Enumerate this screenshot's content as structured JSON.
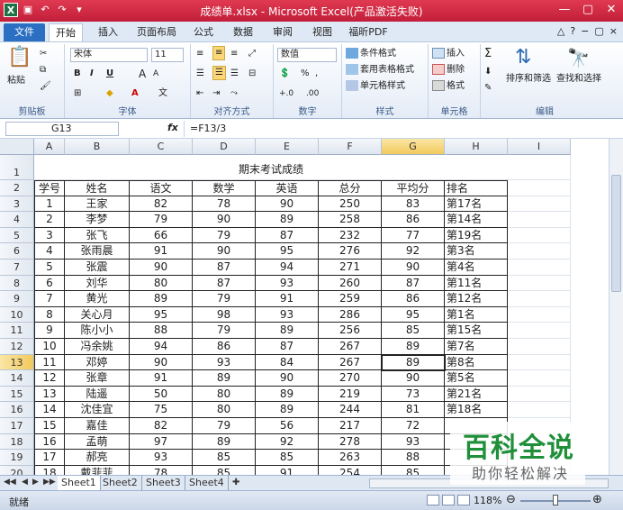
{
  "window": {
    "title": "成绩单.xlsx - Microsoft Excel(产品激活失败)",
    "controls": [
      "—",
      "▢",
      "✕"
    ]
  },
  "ribbon_tabs": [
    "文件",
    "开始",
    "插入",
    "页面布局",
    "公式",
    "数据",
    "审阅",
    "视图",
    "福昕PDF"
  ],
  "ribbon": {
    "clipboard": {
      "paste": "粘贴",
      "label": "剪贴板"
    },
    "font": {
      "name": "宋体",
      "size": "11",
      "bold": "B",
      "italic": "I",
      "underline": "U",
      "grow": "A",
      "shrink": "A",
      "label": "字体",
      "wen": "文"
    },
    "align": {
      "label": "对齐方式"
    },
    "number": {
      "format": "数值",
      "label": "数字",
      "percent": "%",
      "comma": ",",
      "inc": "+.0",
      "dec": ".00"
    },
    "styles": {
      "cond": "条件格式",
      "table": "套用表格格式",
      "cell": "单元格样式",
      "label": "样式"
    },
    "cells": {
      "insert": "插入",
      "delete": "删除",
      "format": "格式",
      "label": "单元格"
    },
    "editing": {
      "sigma": "Σ",
      "sort": "排序和筛选",
      "find": "查找和选择",
      "label": "编辑"
    }
  },
  "formula_bar": {
    "name_box": "G13",
    "fx": "fx",
    "formula": "=F13/3"
  },
  "columns": [
    "A",
    "B",
    "C",
    "D",
    "E",
    "F",
    "G",
    "H",
    "I"
  ],
  "selected": {
    "col": "G",
    "row": "13"
  },
  "sheet": {
    "title": "期末考试成绩",
    "headers": [
      "学号",
      "姓名",
      "语文",
      "数学",
      "英语",
      "总分",
      "平均分",
      "排名"
    ],
    "rows": [
      [
        "1",
        "王家",
        "82",
        "78",
        "90",
        "250",
        "83",
        "第17名"
      ],
      [
        "2",
        "李梦",
        "79",
        "90",
        "89",
        "258",
        "86",
        "第14名"
      ],
      [
        "3",
        "张飞",
        "66",
        "79",
        "87",
        "232",
        "77",
        "第19名"
      ],
      [
        "4",
        "张雨晨",
        "91",
        "90",
        "95",
        "276",
        "92",
        "第3名"
      ],
      [
        "5",
        "张震",
        "90",
        "87",
        "94",
        "271",
        "90",
        "第4名"
      ],
      [
        "6",
        "刘华",
        "80",
        "87",
        "93",
        "260",
        "87",
        "第11名"
      ],
      [
        "7",
        "黄光",
        "89",
        "79",
        "91",
        "259",
        "86",
        "第12名"
      ],
      [
        "8",
        "关心月",
        "95",
        "98",
        "93",
        "286",
        "95",
        "第1名"
      ],
      [
        "9",
        "陈小小",
        "88",
        "79",
        "89",
        "256",
        "85",
        "第15名"
      ],
      [
        "10",
        "冯余姚",
        "94",
        "86",
        "87",
        "267",
        "89",
        "第7名"
      ],
      [
        "11",
        "邓婷",
        "90",
        "93",
        "84",
        "267",
        "89",
        "第8名"
      ],
      [
        "12",
        "张章",
        "91",
        "89",
        "90",
        "270",
        "90",
        "第5名"
      ],
      [
        "13",
        "陆遥",
        "50",
        "80",
        "89",
        "219",
        "73",
        "第21名"
      ],
      [
        "14",
        "沈佳宜",
        "75",
        "80",
        "89",
        "244",
        "81",
        "第18名"
      ],
      [
        "15",
        "嘉佳",
        "82",
        "79",
        "56",
        "217",
        "72",
        ""
      ],
      [
        "16",
        "孟萌",
        "97",
        "89",
        "92",
        "278",
        "93",
        ""
      ],
      [
        "17",
        "郝亮",
        "93",
        "85",
        "85",
        "263",
        "88",
        ""
      ],
      [
        "18",
        "戴菲菲",
        "78",
        "85",
        "91",
        "254",
        "85",
        ""
      ]
    ],
    "row_numbers": [
      "1",
      "2",
      "3",
      "4",
      "5",
      "6",
      "7",
      "8",
      "9",
      "10",
      "11",
      "12",
      "13",
      "14",
      "15",
      "16",
      "17",
      "18",
      "19",
      "20"
    ]
  },
  "sheet_tabs": [
    "Sheet1",
    "Sheet2",
    "Sheet3",
    "Sheet4"
  ],
  "status": {
    "ready": "就绪",
    "zoom": "118%"
  },
  "watermark": {
    "main": "百科全说",
    "sub": "助你轻松解决"
  }
}
